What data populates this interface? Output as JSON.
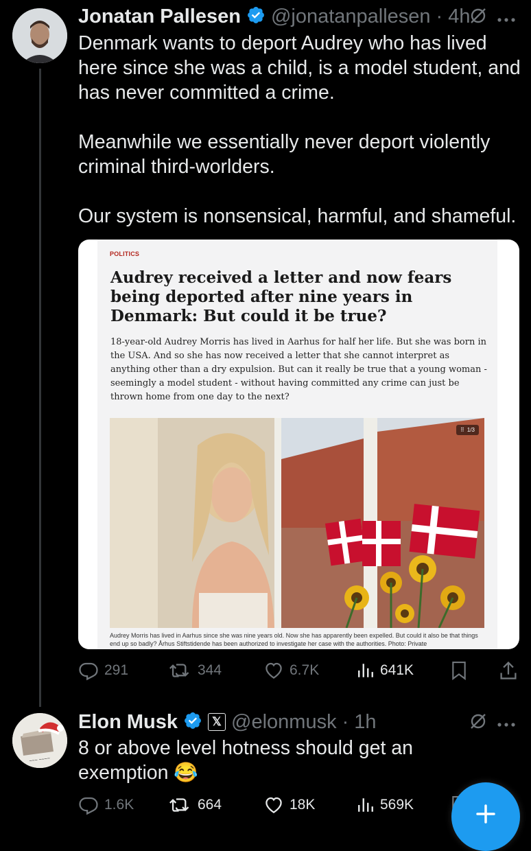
{
  "tweet1": {
    "name": "Jonatan Pallesen",
    "handle": "@jonatanpallesen",
    "time": "4h",
    "verified": true,
    "paragraphs": [
      "Denmark wants to deport Audrey who has lived here since she was a child, is a model student, and has never committed a crime.",
      "Meanwhile we essentially never deport violently criminal third-worlders.",
      "Our system is nonsensical, harmful, and shameful."
    ],
    "article": {
      "section": "POLITICS",
      "headline": "Audrey received a letter and now fears being deported after nine years in Denmark: But could it be true?",
      "lede": "18-year-old Audrey Morris has lived in Aarhus for half her life. But she was born in the USA. And so she has now received a letter that she cannot interpret as anything other than a dry expulsion. But can it really be true that a young woman - seemingly a model student - without having committed any crime can just be thrown home from one day to the next?",
      "gallery_counter": "1/3",
      "caption": "Audrey Morris has lived in Aarhus since she was nine years old. Now she has apparently been expelled. But could it also be that things end up so badly? Århus Stiftstidende has been authorized to investigate her case with the authorities. Photo: Private"
    },
    "stats": {
      "replies": "291",
      "reposts": "344",
      "likes": "6.7K",
      "views": "641K"
    }
  },
  "tweet2": {
    "name": "Elon Musk",
    "handle": "@elonmusk",
    "time": "1h",
    "verified": true,
    "text": "8 or above level hotness should get an exemption",
    "emoji": "😂",
    "stats": {
      "replies": "1.6K",
      "reposts": "664",
      "likes": "18K",
      "views": "569K"
    }
  },
  "colors": {
    "accent": "#1d9bf0",
    "muted": "#71767b",
    "text": "#e7e9ea",
    "background": "#000000"
  },
  "icons": [
    "verified-badge-icon",
    "grok-icon",
    "more-icon",
    "reply-icon",
    "repost-icon",
    "like-icon",
    "views-icon",
    "bookmark-icon",
    "share-icon",
    "x-affiliate-icon",
    "compose-plus-icon"
  ]
}
